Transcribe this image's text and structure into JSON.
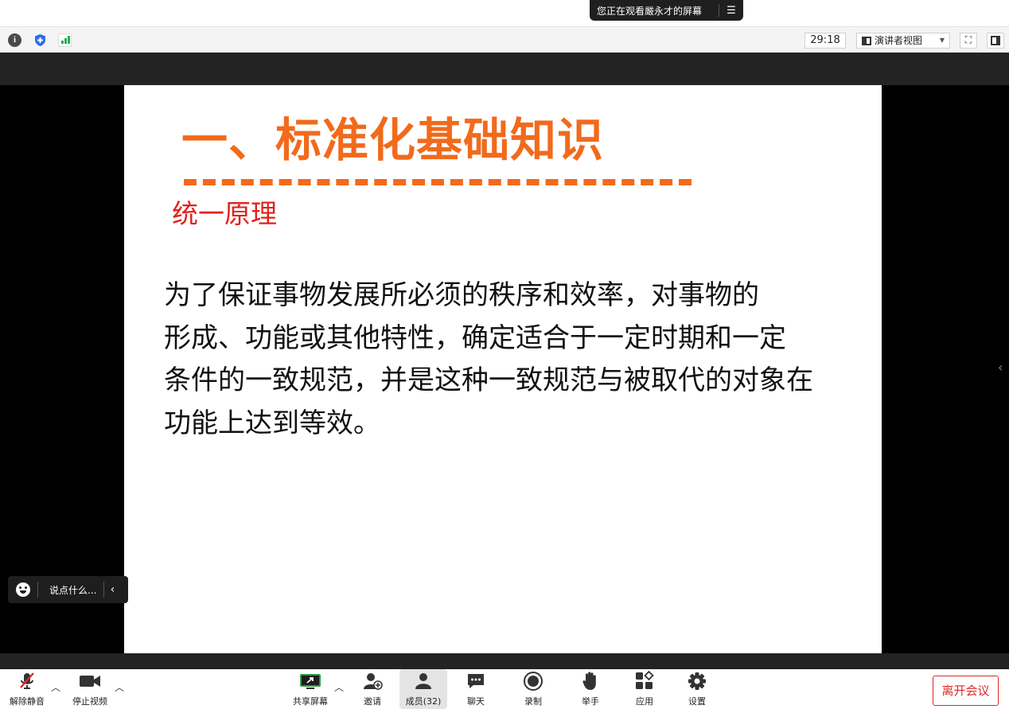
{
  "share_banner": {
    "text": "您正在观看嚴永才的屏幕",
    "menu_icon": "list-menu-icon"
  },
  "topbar": {
    "timer": "29:18",
    "view_label": "演讲者视图",
    "icons": [
      "info-icon",
      "shield-icon",
      "signal-icon",
      "fullscreen-icon",
      "panel-icon"
    ]
  },
  "slide": {
    "title": "一、标准化基础知识",
    "subtitle": "统一原理",
    "body_lines": [
      " 为了保证事物发展所必须的秩序和效率，对事物的",
      "形成、功能或其他特性，确定适合于一定时期和一定",
      "条件的一致规范，并是这种一致规范与被取代的对象在",
      "功能上达到等效。"
    ],
    "title_color": "#f26a1b",
    "subtitle_color": "#e2211c"
  },
  "reactions": {
    "placeholder": "说点什么...",
    "icon": "emoji-icon"
  },
  "toolbar": {
    "unmute": "解除静音",
    "stop_video": "停止视频",
    "share_screen": "共享屏幕",
    "invite": "邀请",
    "members": "成员(32)",
    "chat": "聊天",
    "record": "录制",
    "raise_hand": "举手",
    "apps": "应用",
    "settings": "设置",
    "leave": "离开会议",
    "leave_color": "#e02828"
  }
}
